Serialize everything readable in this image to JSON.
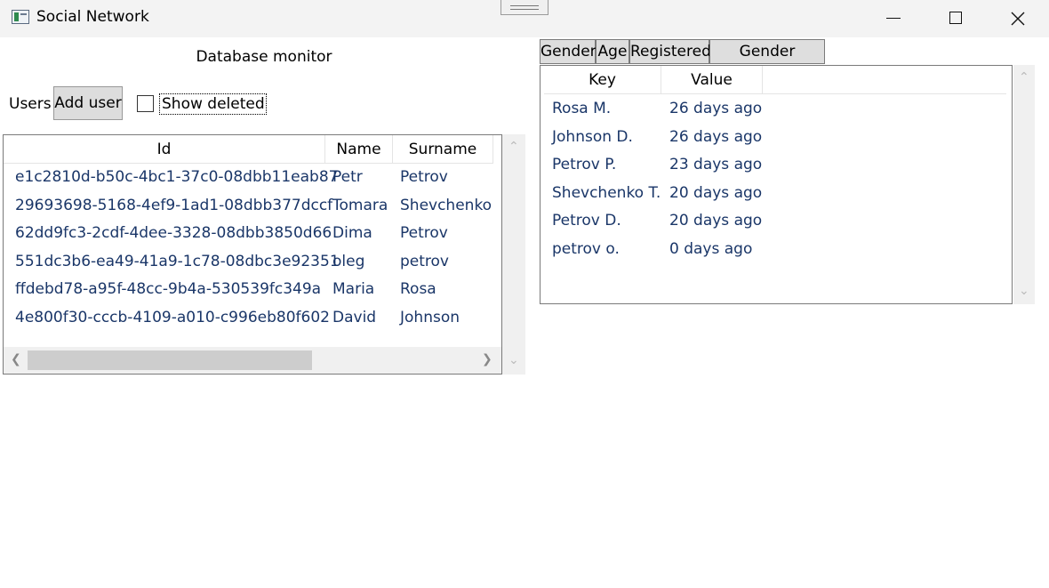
{
  "window": {
    "title": "Social Network"
  },
  "header": {
    "title": "Database monitor"
  },
  "toolbar": {
    "users_label": "Users",
    "add_user_label": "Add user",
    "show_deleted_label": "Show deleted",
    "show_deleted_checked": false
  },
  "users_table": {
    "columns": [
      "Id",
      "Name",
      "Surname"
    ],
    "rows": [
      [
        "e1c2810d-b50c-4bc1-37c0-08dbb11eab87",
        "Petr",
        "Petrov"
      ],
      [
        "29693698-5168-4ef9-1ad1-08dbb377dccf",
        "Tomara",
        "Shevchenko"
      ],
      [
        "62dd9fc3-2cdf-4dee-3328-08dbb3850d66",
        "Dima",
        "Petrov"
      ],
      [
        "551dc3b6-ea49-41a9-1c78-08dbc3e92351",
        "oleg",
        "petrov"
      ],
      [
        "ffdebd78-a95f-48cc-9b4a-530539fc349a",
        "Maria",
        "Rosa"
      ],
      [
        "4e800f30-cccb-4109-a010-c996eb80f602",
        "David",
        "Johnson"
      ]
    ]
  },
  "stats": {
    "tabs": [
      "Gender",
      "Age",
      "Registered",
      "Gender Statistic"
    ],
    "columns": [
      "Key",
      "Value"
    ],
    "rows": [
      [
        "Rosa M.",
        "26 days ago"
      ],
      [
        "Johnson D.",
        "26 days ago"
      ],
      [
        "Petrov P.",
        "23 days ago"
      ],
      [
        "Shevchenko T.",
        "20 days ago"
      ],
      [
        "Petrov D.",
        "20 days ago"
      ],
      [
        "petrov o.",
        "0 days ago"
      ]
    ]
  },
  "colors": {
    "cell_text": "#1a3668",
    "titlebar": "#f3f3f3",
    "button": "#dddddd"
  }
}
